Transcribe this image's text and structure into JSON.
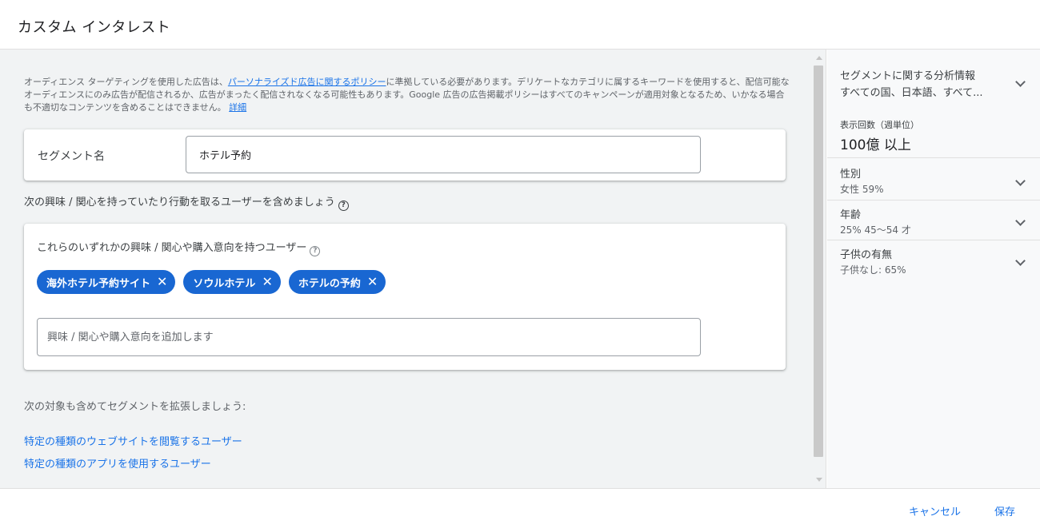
{
  "header": {
    "title": "カスタム インタレスト"
  },
  "notice": {
    "text_before": "オーディエンス ターゲティングを使用した広告は、",
    "link_text": "パーソナライズド広告に関するポリシー",
    "text_after": "に準拠している必要があります。デリケートなカテゴリに属するキーワードを使用すると、配信可能なオーディエンスにのみ広告が配信されるか、広告がまったく配信されなくなる可能性もあります。Google 広告の広告掲載ポリシーはすべてのキャンペーンが適用対象となるため、いかなる場合も不適切なコンテンツを含めることはできません。",
    "detail_link": "詳細"
  },
  "segment": {
    "label": "セグメント名",
    "value": "ホテル予約"
  },
  "include": {
    "label": "次の興味 / 関心を持っていたり行動を取るユーザーを含めましょう",
    "help_icon": "help-circle-icon"
  },
  "interests": {
    "title": "これらのいずれかの興味 / 関心や購入意向を持つユーザー",
    "chips": [
      {
        "label": "海外ホテル予約サイト"
      },
      {
        "label": "ソウルホテル"
      },
      {
        "label": "ホテルの予約"
      }
    ],
    "remove_glyph": "✕",
    "placeholder": "興味 / 関心や購入意向を追加します",
    "chip_color": "#1967d2"
  },
  "expand": {
    "label": "次の対象も含めてセグメントを拡張しましょう:",
    "link_web": "特定の種類のウェブサイトを閲覧するユーザー",
    "link_app": "特定の種類のアプリを使用するユーザー"
  },
  "side": {
    "insights_title": "セグメントに関する分析情報",
    "insights_sub": "すべての国、日本語、すべて...",
    "impressions_label": "表示回数（週単位）",
    "impressions_value": "100億 以上",
    "gender_title": "性別",
    "gender_value": "女性 59%",
    "age_title": "年齢",
    "age_value": "25% 45～54 才",
    "children_title": "子供の有無",
    "children_value": "子供なし: 65%"
  },
  "footer": {
    "cancel": "キャンセル",
    "save": "保存"
  },
  "colors": {
    "accent": "#1a73e8",
    "panel_bg": "#f1f3f4"
  }
}
